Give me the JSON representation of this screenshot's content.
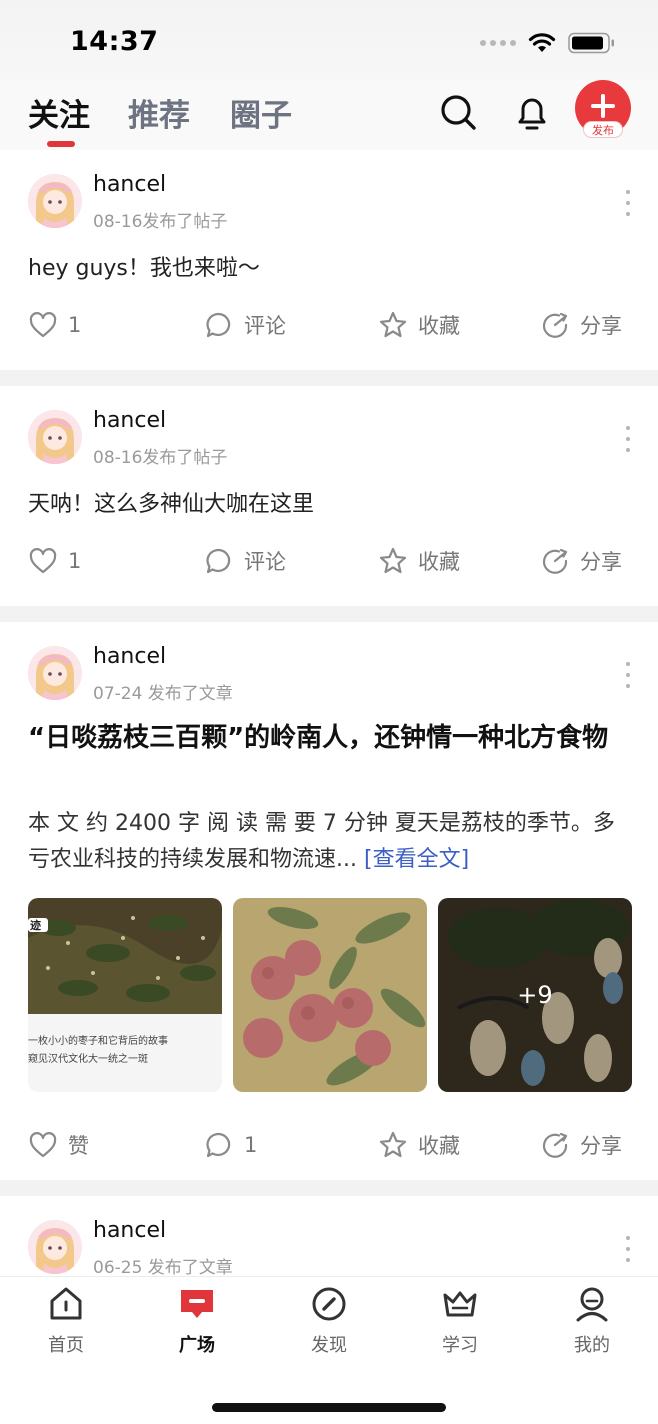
{
  "status": {
    "time": "14:37"
  },
  "tabs": [
    {
      "label": "关注",
      "active": true
    },
    {
      "label": "推荐",
      "active": false
    },
    {
      "label": "圈子",
      "active": false
    }
  ],
  "header": {
    "publish_label": "发布",
    "accent": "#e0353b"
  },
  "posts": [
    {
      "user": "hancel",
      "meta": "08-16发布了帖子",
      "text": "hey guys！我也来啦～",
      "like": "1",
      "comment": "评论",
      "fav": "收藏",
      "share": "分享"
    },
    {
      "user": "hancel",
      "meta": "08-16发布了帖子",
      "text": "天呐！这么多神仙大咖在这里",
      "like": "1",
      "comment": "评论",
      "fav": "收藏",
      "share": "分享"
    },
    {
      "user": "hancel",
      "meta": "07-24 发布了文章",
      "title": "“日啖荔枝三百颗”的岭南人，还钟情一种北方食物",
      "excerpt": " 本 文 约 2400 字 阅 读 需 要 7 分钟  夏天是荔枝的季节。多亏农业科技的持续发展和物流速...",
      "read_more": "[查看全文]",
      "thumb1_tag": "迹",
      "thumb1_caption1": "一枚小小的枣子和它背后的故事",
      "thumb1_caption2": "窥见汉代文化大一统之一斑",
      "more_images": "+9",
      "like": "赞",
      "comment": "1",
      "fav": "收藏",
      "share": "分享"
    },
    {
      "user": "hancel",
      "meta": "06-25 发布了文章"
    }
  ],
  "tabbar": [
    {
      "label": "首页",
      "icon": "home-icon"
    },
    {
      "label": "广场",
      "icon": "square-icon",
      "active": true
    },
    {
      "label": "发现",
      "icon": "compass-icon"
    },
    {
      "label": "学习",
      "icon": "crown-icon"
    },
    {
      "label": "我的",
      "icon": "profile-icon"
    }
  ]
}
